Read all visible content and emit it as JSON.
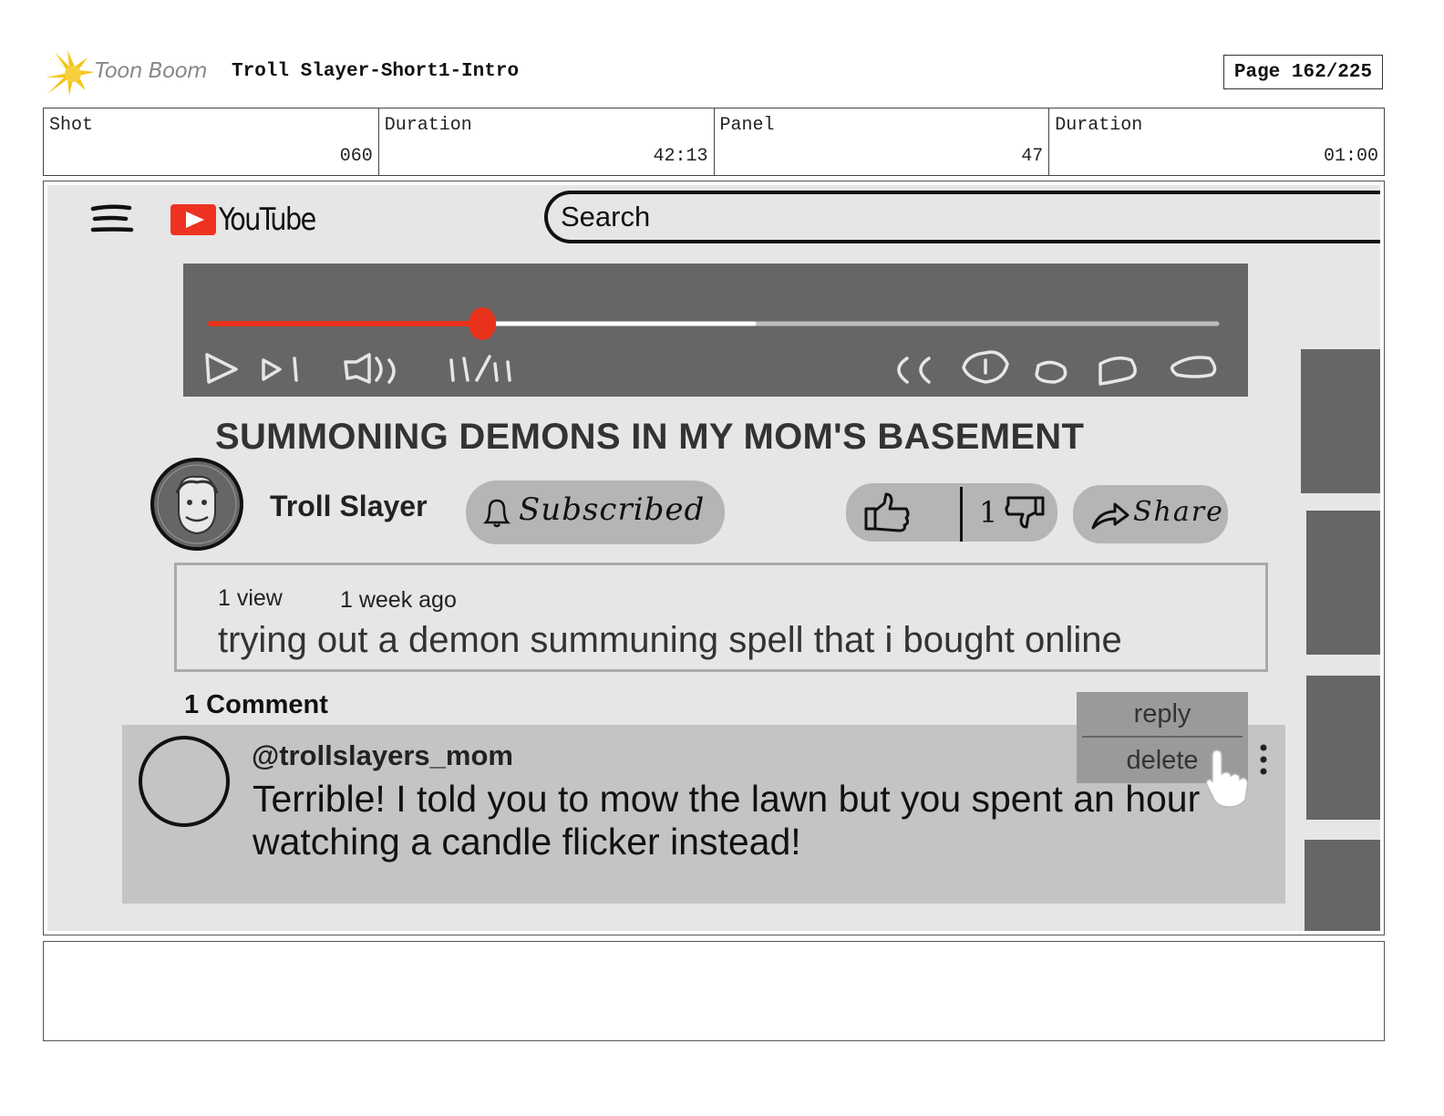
{
  "header": {
    "logo_text": "Toon Boom",
    "project_title": "Troll Slayer-Short1-Intro",
    "page_label": "Page 162/225"
  },
  "info": {
    "shot_label": "Shot",
    "shot_value": "060",
    "shot_duration_label": "Duration",
    "shot_duration_value": "42:13",
    "panel_label": "Panel",
    "panel_value": "47",
    "panel_duration_label": "Duration",
    "panel_duration_value": "01:00"
  },
  "youtube": {
    "logo_text": "YouTube",
    "search_placeholder": "Search",
    "player": {
      "progress": 0.27,
      "buffered": 0.54,
      "time_display": "11/11",
      "colors": {
        "played": "#e8321c",
        "buffered": "#ffffff",
        "track": "#bdbdbd",
        "background": "#666666"
      }
    },
    "video_title": "SUMMONING DEMONS IN MY MOM'S BASEMENT",
    "channel_name": "Troll Slayer",
    "subscribe_label": "Subscribed",
    "dislike_count": "1",
    "share_label": "Share",
    "description": {
      "views": "1 view",
      "date": "1 week ago",
      "text": "trying out a demon summuning spell that i bought online"
    },
    "comments": {
      "count_label": "1 Comment",
      "items": [
        {
          "author": "@trollslayers_mom",
          "text": "Terrible! I told you to mow the lawn but you spent an hour watching a candle flicker instead!"
        }
      ]
    },
    "context_menu": {
      "reply": "reply",
      "delete": "delete"
    }
  }
}
